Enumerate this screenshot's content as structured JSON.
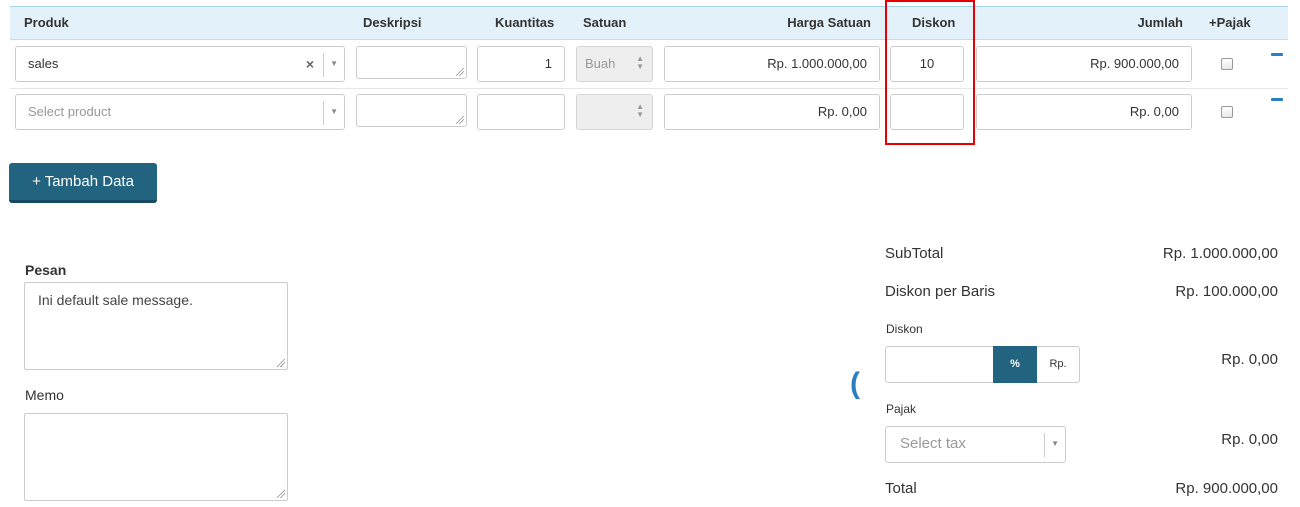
{
  "table": {
    "headers": {
      "produk": "Produk",
      "deskripsi": "Deskripsi",
      "kuantitas": "Kuantitas",
      "satuan": "Satuan",
      "harga_satuan": "Harga Satuan",
      "diskon": "Diskon",
      "jumlah": "Jumlah",
      "pajak": "+Pajak"
    },
    "rows": [
      {
        "product": "sales",
        "clear_glyph": "×",
        "description": "",
        "quantity": "1",
        "unit": "Buah",
        "unit_price": "Rp. 1.000.000,00",
        "discount": "10",
        "amount": "Rp. 900.000,00",
        "tax_checked": false
      },
      {
        "product_placeholder": "Select product",
        "description": "",
        "quantity": "",
        "unit": "",
        "unit_price": "Rp. 0,00",
        "discount": "",
        "amount": "Rp. 0,00",
        "tax_checked": false
      }
    ]
  },
  "add_button": "+ Tambah Data",
  "message": {
    "label": "Pesan",
    "value": "Ini default sale message."
  },
  "memo": {
    "label": "Memo",
    "value": ""
  },
  "summary": {
    "subtotal_label": "SubTotal",
    "subtotal_value": "Rp. 1.000.000,00",
    "line_discount_label": "Diskon per Baris",
    "line_discount_value": "Rp. 100.000,00",
    "discount_label": "Diskon",
    "discount_input": "",
    "discount_mode_pct": "%",
    "discount_mode_rp": "Rp.",
    "discount_value": "Rp. 0,00",
    "tax_label": "Pajak",
    "tax_placeholder": "Select tax",
    "tax_value": "Rp. 0,00",
    "total_label": "Total",
    "total_value": "Rp. 900.000,00"
  },
  "colors": {
    "accent": "#22647f",
    "header_bg": "#e3f2fa",
    "highlight": "#e60000",
    "minus": "#2a7fc1"
  }
}
